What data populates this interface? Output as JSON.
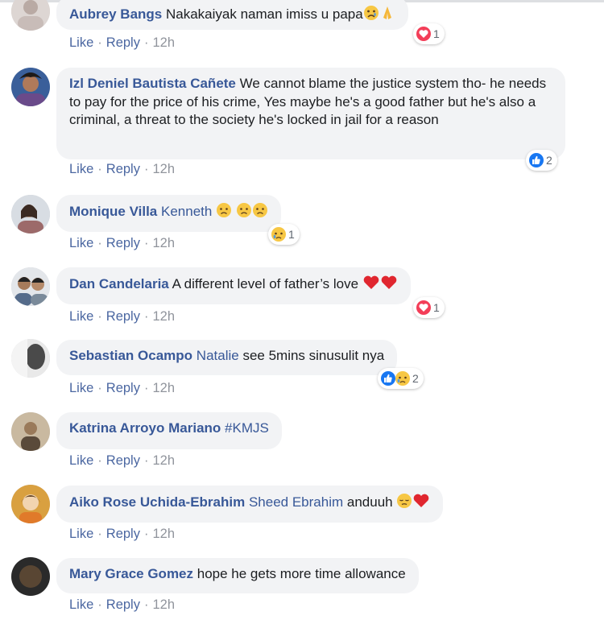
{
  "actions": {
    "like": "Like",
    "reply": "Reply",
    "separator": "·"
  },
  "comments": [
    {
      "author": "Aubrey Bangs",
      "tag": "",
      "text": "Nakakaiyak naman imiss u papa",
      "emojis": [
        "sad-face-icon",
        "praying-hands-icon"
      ],
      "reactions": [
        "heart-react-icon"
      ],
      "react_count": "1",
      "time": "12h"
    },
    {
      "author": "Izl Deniel Bautista Cañete",
      "tag": "",
      "text": "We cannot blame the justice system tho- he needs to pay for the price of his crime, Yes maybe he's a good father but he's also a criminal, a threat to the society he's locked in jail for a reason",
      "emojis": [],
      "reactions": [
        "like-react-icon"
      ],
      "react_count": "2",
      "time": "12h"
    },
    {
      "author": "Monique Villa",
      "tag": "Kenneth",
      "text": "",
      "emojis": [
        "frown-face-icon",
        "frown-face-icon",
        "frown-face-icon"
      ],
      "reactions": [
        "sad-react-icon"
      ],
      "react_count": "1",
      "time": "12h"
    },
    {
      "author": "Dan Candelaria",
      "tag": "",
      "text": "A different level of father’s love",
      "emojis": [
        "red-heart-icon",
        "red-heart-icon"
      ],
      "reactions": [
        "heart-react-icon"
      ],
      "react_count": "1",
      "time": "12h"
    },
    {
      "author": "Sebastian Ocampo",
      "tag": "Natalie",
      "text": "see 5mins sinusulit nya",
      "emojis": [],
      "reactions": [
        "like-react-icon",
        "sad-react-icon"
      ],
      "react_count": "2",
      "time": "12h"
    },
    {
      "author": "Katrina Arroyo Mariano",
      "tag": "#KMJS",
      "text": "",
      "emojis": [],
      "reactions": [],
      "react_count": "",
      "time": "12h"
    },
    {
      "author": "Aiko Rose Uchida-Ebrahim",
      "tag": "Sheed Ebrahim",
      "text": "anduuh",
      "emojis": [
        "pensive-face-icon",
        "red-heart-icon"
      ],
      "reactions": [],
      "react_count": "",
      "time": "12h"
    },
    {
      "author": "Mary Grace Gomez",
      "tag": "",
      "text": "hope he gets more time allowance",
      "emojis": [],
      "reactions": [],
      "react_count": "",
      "time": "12h"
    }
  ],
  "colors": {
    "author": "#385898",
    "bubble": "#f2f3f5",
    "like_blue": "#1877f2",
    "heart_red": "#f33e58",
    "emoji_yellow": "#f7c744"
  }
}
